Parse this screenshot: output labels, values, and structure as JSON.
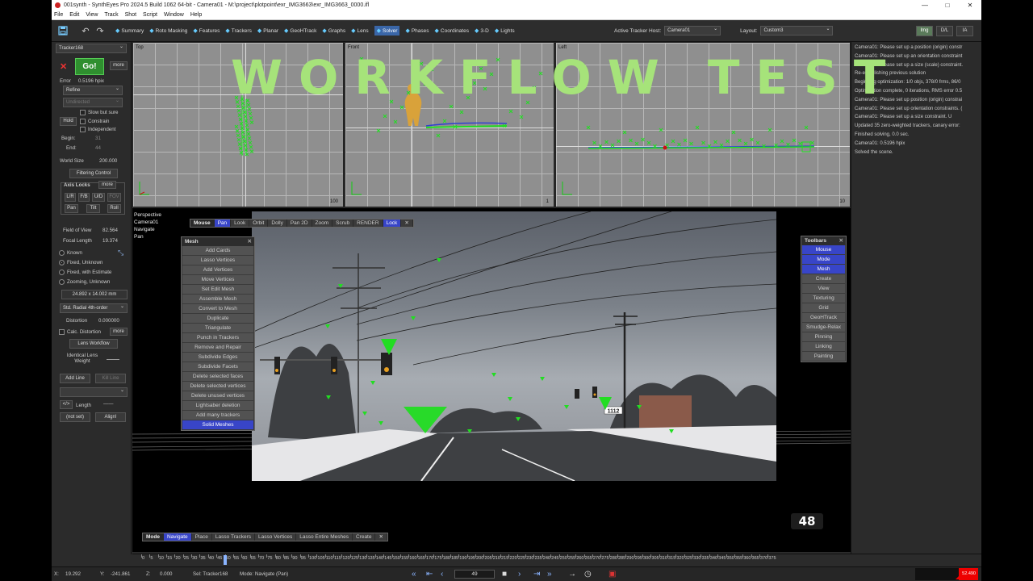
{
  "window": {
    "title": "001synth - SynthEyes Pro 2024.5 Build 1062 64-bit - Camera01 - M:\\project\\plotpoint\\exr_IMG3663\\exr_IMG3663_0000.ifl",
    "controls": [
      "—",
      "□",
      "✕"
    ]
  },
  "menu": [
    "File",
    "Edit",
    "View",
    "Track",
    "Shot",
    "Script",
    "Window",
    "Help"
  ],
  "toolbar": {
    "rooms": [
      {
        "label": "Summary",
        "icon": "summary-icon"
      },
      {
        "label": "Roto Masking",
        "icon": "roto-icon"
      },
      {
        "label": "Features",
        "icon": "features-icon"
      },
      {
        "label": "Trackers",
        "icon": "trackers-icon"
      },
      {
        "label": "Planar",
        "icon": "planar-icon"
      },
      {
        "label": "GeoHTrack",
        "icon": "geohtrack-icon"
      },
      {
        "label": "Graphs",
        "icon": "graphs-icon"
      },
      {
        "label": "Lens",
        "icon": "lens-icon"
      },
      {
        "label": "Solver",
        "icon": "solver-icon",
        "active": true
      },
      {
        "label": "Phases",
        "icon": "phases-icon"
      },
      {
        "label": "Coordinates",
        "icon": "coordinates-icon"
      },
      {
        "label": "3-D",
        "icon": "3d-icon"
      },
      {
        "label": "Lights",
        "icon": "lights-icon"
      }
    ],
    "active_tracker_host_label": "Active Tracker Host:",
    "active_tracker_host": "Camera01",
    "layout_label": "Layout:",
    "layout": "Custom3",
    "buttons": [
      "Img",
      "D/L",
      "IA"
    ]
  },
  "left_panel": {
    "tracker": "Tracker168",
    "go": "Go!",
    "more": "more",
    "error_label": "Error",
    "error_value": "0.5196 hpix",
    "refine": "Refine",
    "undirected": "Undirected",
    "slow_but_sure": "Slow but sure",
    "hold": "Hold",
    "constrain": "Constrain",
    "independent": "Independent",
    "begin_label": "Begin:",
    "begin_value": "31",
    "end_label": "End:",
    "end_value": "44",
    "world_size_label": "World Size",
    "world_size_value": "200.000",
    "filtering_control": "Filtering Control",
    "axis_locks": "Axis Locks",
    "axis_more": "more",
    "lr": "L/R",
    "fb": "F/B",
    "ud": "U/D",
    "fov": "FOV",
    "pan": "Pan",
    "tilt": "Tilt",
    "roll": "Roll",
    "fov_label": "Field of View",
    "fov_value": "82.564",
    "focal_label": "Focal Length",
    "focal_value": "19.374",
    "known": "Known",
    "fixed_unknown": "Fixed, Unknown",
    "fixed_estimate": "Fixed, with Estimate",
    "zooming_unknown": "Zooming, Unknown",
    "back_plate": "24.892 x 14.002 mm",
    "lens_model": "Std. Radial 4th-order",
    "distortion_label": "Distortion",
    "distortion_value": "0.000000",
    "calc_distortion": "Calc. Distortion",
    "calc_more": "more",
    "lens_workflow": "Lens Workflow",
    "identical_lens_weight": "Identical Lens Weight",
    "add_line": "Add Line",
    "kill_line": "Kill Line",
    "code": "</>",
    "length_label": "Length",
    "length_value": "——",
    "not_set": "(not set)",
    "align": "Align!"
  },
  "viewports": {
    "top": {
      "label": "Top",
      "num": "100"
    },
    "front": {
      "label": "Front",
      "num": "1"
    },
    "left": {
      "label": "Left",
      "num": "10"
    }
  },
  "log": [
    "Camera01: Please set up a position (origin) constr",
    "Camera01: Please set up an orientation constraint",
    "Camera01: Please set up a size (scale) constraint.",
    "Re-establishing previous solution",
    "Beginning optimization: 1/0 objs, 378/0 frms, 86/0",
    "Optimization complete, 0 iterations, RMS error 0.5",
    "Camera01: Please set up position (origin) constrai",
    "Camera01: Please set up orientation constraints. (",
    "Camera01: Please set up a size constraint. U",
    "Updated 35 zero-weighted trackers, canary error:",
    "Finished solving, 0.0 sec.",
    "Camera01: 0.5196 hpix",
    "Solved the scene."
  ],
  "perspective": {
    "info": [
      "Perspective",
      "Camera01",
      "Navigate",
      "Pan"
    ],
    "mouse_bar": [
      "Mouse",
      "Pan",
      "Look",
      "Orbit",
      "Dolly",
      "Pan 2D",
      "Zoom",
      "Scrub",
      "RENDER",
      "Lock",
      "✕"
    ],
    "mesh_title": "Mesh",
    "mesh_items": [
      "Add Cards",
      "Lasso Vertices",
      "Add Vertices",
      "Move Vertices",
      "Set Edit Mesh",
      "Assemble Mesh",
      "Convert to Mesh",
      "Duplicate",
      "Triangulate",
      "Punch in Trackers",
      "Remove and Repair",
      "Subdivide Edges",
      "Subdivide Facets",
      "Delete selected faces",
      "Delete selected vertices",
      "Delete unused vertices",
      "Lightsaber deletion",
      "Add many trackers",
      "Solid Meshes"
    ],
    "toolbars_title": "Toolbars",
    "toolbars_items": [
      "Mouse",
      "Mode",
      "Mesh",
      "Create",
      "View",
      "Texturing",
      "Grid",
      "GeoHTrack",
      "Smudge-Relax",
      "Pinning",
      "Linking",
      "Painting"
    ],
    "mode_bar": [
      "Mode",
      "Navigate",
      "Place",
      "Lasso Trackers",
      "Lasso Vertices",
      "Lasso Entire Meshes",
      "Create",
      "✕"
    ],
    "sign_text": "1112"
  },
  "overlay": {
    "title": "WORKFLOW TEST",
    "frame": "48"
  },
  "timeline": {
    "ticks": [
      "0",
      "5",
      "10",
      "15",
      "20",
      "25",
      "30",
      "35",
      "40",
      "45",
      "50",
      "55",
      "60",
      "65",
      "70",
      "75",
      "80",
      "85",
      "90",
      "95",
      "100",
      "105",
      "110",
      "115",
      "120",
      "125",
      "130",
      "135",
      "140",
      "145",
      "150",
      "155",
      "160",
      "165",
      "170",
      "175",
      "180",
      "185",
      "190",
      "195",
      "200",
      "205",
      "210",
      "215",
      "220",
      "225",
      "230",
      "235",
      "240",
      "245",
      "250",
      "255",
      "260",
      "265",
      "270",
      "275",
      "280",
      "285",
      "290",
      "295",
      "300",
      "305",
      "310",
      "315",
      "320",
      "325",
      "330",
      "335",
      "340",
      "345",
      "350",
      "355",
      "360",
      "365",
      "370",
      "375"
    ],
    "current_frame": 49
  },
  "status": {
    "x_label": "X:",
    "x_value": "19.292",
    "y_label": "Y:",
    "y_value": "-241.861",
    "z_label": "Z:",
    "z_value": "0.000",
    "sel": "Sel: Tracker168",
    "mode": "Mode: Navigate (Pan)",
    "frame_field": "49",
    "err_meter": "52.490 hpix"
  },
  "colors": {
    "accent_blue": "#3845c8",
    "go_green": "#2f8f2f",
    "overlay_green": "#a6e37a",
    "tracker_green": "#22dd22",
    "error_red": "#e00000"
  }
}
